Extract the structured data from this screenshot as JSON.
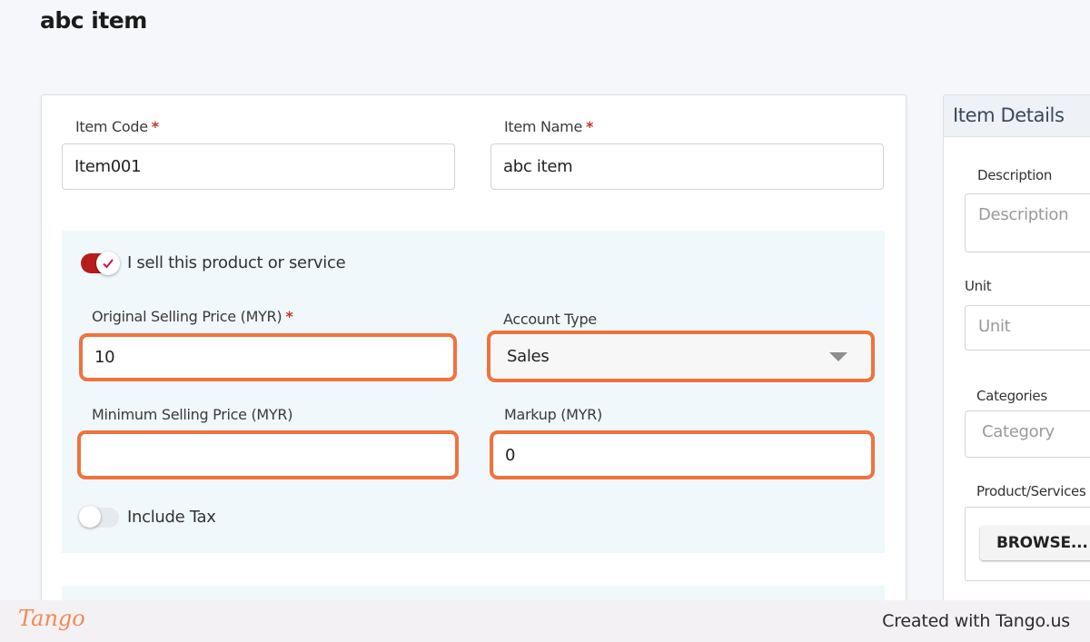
{
  "page": {
    "title": "abc item"
  },
  "form": {
    "item_code": {
      "label": "Item Code",
      "required": "*",
      "value": "Item001"
    },
    "item_name": {
      "label": "Item Name",
      "required": "*",
      "value": "abc item"
    },
    "sell_toggle": {
      "label": "I sell this product or service",
      "checked": true
    },
    "original_price": {
      "label": "Original Selling Price (MYR)",
      "required": "*",
      "value": "10"
    },
    "account_type": {
      "label": "Account Type",
      "value": "Sales"
    },
    "minimum_price": {
      "label": "Minimum Selling Price (MYR)",
      "value": ""
    },
    "markup": {
      "label": "Markup (MYR)",
      "value": "0"
    },
    "include_tax": {
      "label": "Include Tax",
      "checked": false
    }
  },
  "details": {
    "title": "Item Details",
    "description": {
      "label": "Description",
      "placeholder": "Description"
    },
    "unit": {
      "label": "Unit",
      "placeholder": "Unit"
    },
    "categories": {
      "label": "Categories",
      "placeholder": "Category"
    },
    "product_services": {
      "label": "Product/Services",
      "button": "BROWSE..."
    }
  },
  "footer": {
    "logo": "Tango",
    "credit": "Created with Tango.us"
  },
  "colors": {
    "toggle_on": "#b71c1c",
    "highlight": "#f0723d",
    "panel_bg": "#f1f8fc",
    "required": "#c0392b"
  },
  "icons": {
    "check": "check-icon",
    "caret": "caret-down-icon"
  }
}
